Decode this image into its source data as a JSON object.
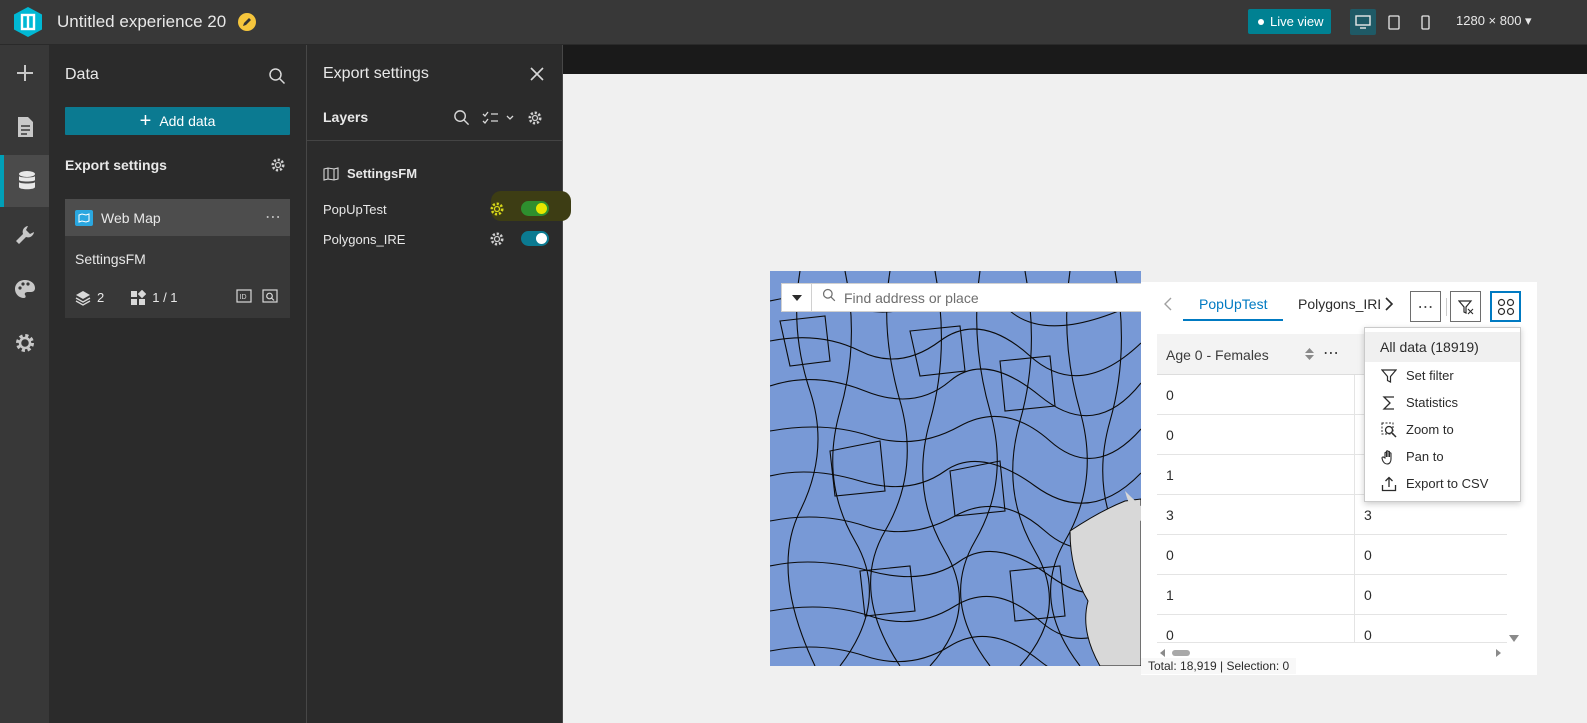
{
  "header": {
    "app_title": "Untitled experience 20",
    "live_view_label": "Live view",
    "screen_size": "1280 × 800",
    "accent": "#008192"
  },
  "rail": {
    "items": [
      "insert",
      "page",
      "data",
      "widget-settings",
      "theme",
      "app-settings"
    ]
  },
  "data_panel": {
    "title": "Data",
    "add_data_label": "Add data",
    "section_title": "Export settings",
    "card": {
      "title": "Web Map",
      "name": "SettingsFM",
      "layer_count": "2",
      "views": "1 / 1"
    }
  },
  "export_panel": {
    "title": "Export settings",
    "layers_title": "Layers",
    "map_name": "SettingsFM",
    "layers": [
      {
        "name": "PopUpTest",
        "highlighted": true
      },
      {
        "name": "Polygons_IRE",
        "highlighted": false
      }
    ]
  },
  "map": {
    "search_placeholder": "Find address or place",
    "fill_color": "#7899d6"
  },
  "table": {
    "tabs": [
      "PopUpTest",
      "Polygons_IRE"
    ],
    "active_tab": "PopUpTest",
    "column": "Age 0 - Females",
    "rows": [
      [
        "0",
        ""
      ],
      [
        "0",
        ""
      ],
      [
        "1",
        ""
      ],
      [
        "3",
        "3"
      ],
      [
        "0",
        "0"
      ],
      [
        "1",
        "0"
      ],
      [
        "0",
        "0"
      ]
    ],
    "footer": "Total: 18,919 | Selection: 0"
  },
  "menu": {
    "items": [
      "All data (18919)",
      "Set filter",
      "Statistics",
      "Zoom to",
      "Pan to",
      "Export to CSV"
    ]
  }
}
